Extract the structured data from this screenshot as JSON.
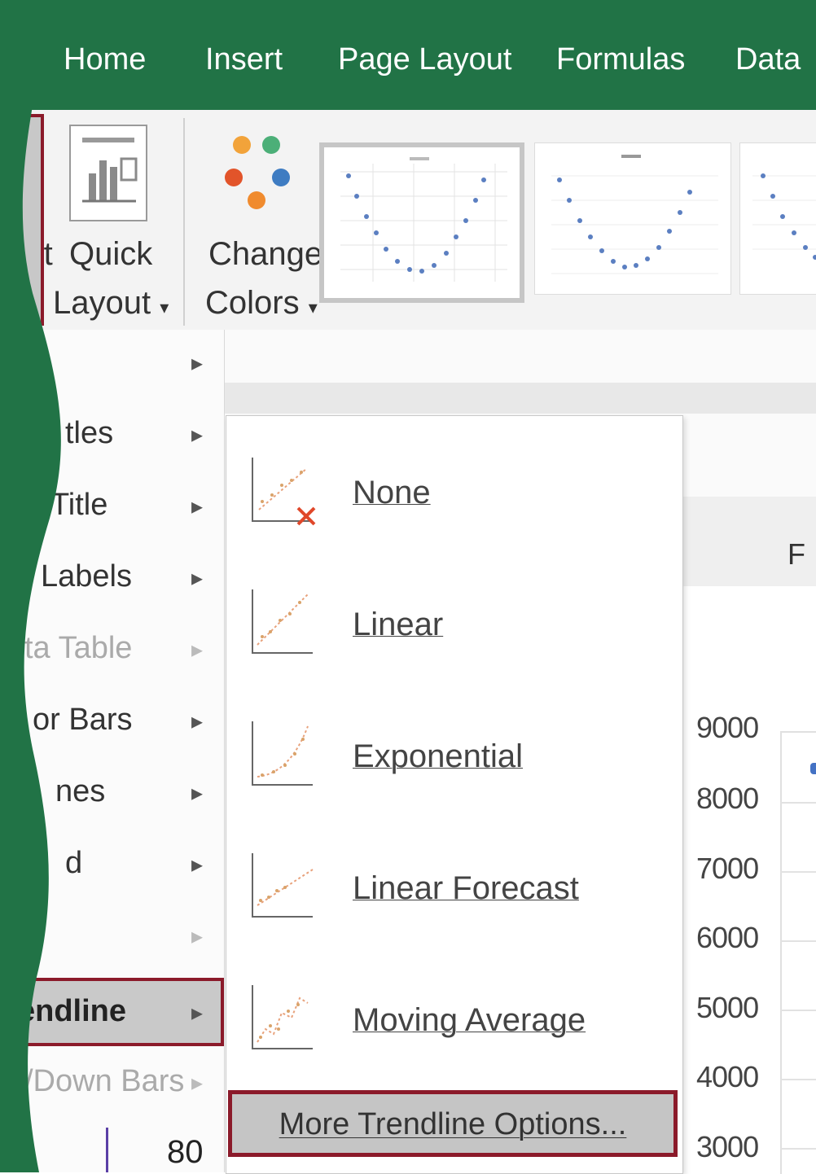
{
  "ribbon": {
    "tabs": [
      "Home",
      "Insert",
      "Page Layout",
      "Formulas",
      "Data"
    ],
    "quick_layout": {
      "line1": "Quick",
      "line2": "Layout",
      "arrow": "▾",
      "icon": "quick-layout-icon"
    },
    "change_colors": {
      "line1": "Change",
      "line2": "Colors",
      "arrow": "▾",
      "icon": "palette-icon"
    },
    "add_chart_element_fragment": {
      "line1": "art",
      "line2": ""
    },
    "colors": {
      "ribbon_green": "#217346",
      "accent_red": "#8b1a2a",
      "palette": [
        "#f2a33a",
        "#4caf78",
        "#e2542a",
        "#3e7cc2",
        "#f08b2e"
      ]
    }
  },
  "menu": {
    "items": [
      {
        "label": "",
        "arrow": "▸",
        "enabled": true
      },
      {
        "label": "tles",
        "arrow": "▸",
        "enabled": true
      },
      {
        "label": "Title",
        "arrow": "▸",
        "enabled": true
      },
      {
        "label": "Labels",
        "arrow": "▸",
        "enabled": true
      },
      {
        "label": "ta Table",
        "arrow": "▸",
        "enabled": false
      },
      {
        "label": "or Bars",
        "arrow": "▸",
        "enabled": true
      },
      {
        "label": "nes",
        "arrow": "▸",
        "enabled": true
      },
      {
        "label": "d",
        "arrow": "▸",
        "enabled": true
      },
      {
        "label": "",
        "arrow": "▸",
        "enabled": false
      },
      {
        "label": "endline",
        "arrow": "▸",
        "enabled": true,
        "selected": true
      },
      {
        "label": "/Down Bars",
        "arrow": "▸",
        "enabled": false
      }
    ]
  },
  "trendline_submenu": {
    "items": [
      {
        "label": "None",
        "icon": "trendline-none-icon"
      },
      {
        "label": "Linear",
        "icon": "trendline-linear-icon"
      },
      {
        "label": "Exponential",
        "icon": "trendline-exponential-icon"
      },
      {
        "label": "Linear Forecast",
        "icon": "trendline-linear-forecast-icon"
      },
      {
        "label": "Moving Average",
        "icon": "trendline-moving-average-icon"
      }
    ],
    "more_options": "More Trendline Options..."
  },
  "sheet": {
    "column_header": "F",
    "cell_value": "80",
    "y_ticks": [
      "9000",
      "8000",
      "7000",
      "6000",
      "5000",
      "4000",
      "3000"
    ]
  }
}
